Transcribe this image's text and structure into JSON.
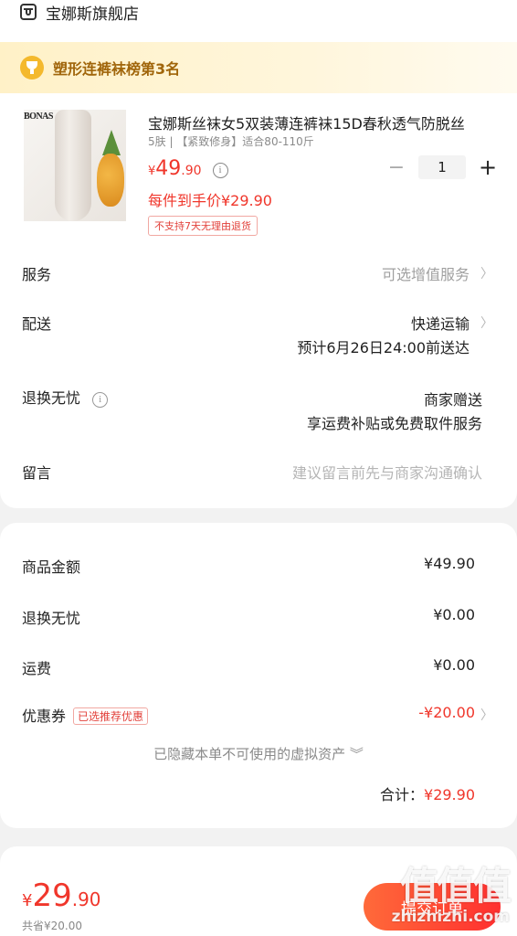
{
  "store": {
    "name": "宝娜斯旗舰店",
    "icon": "store-icon"
  },
  "rank_banner": {
    "text": "塑形连裤袜榜第3名",
    "icon": "trophy-icon"
  },
  "product": {
    "brand_logo_text": "BONAS",
    "title": "宝娜斯丝袜女5双装薄连裤袜15D春秋透气防脱丝",
    "spec": "5肤 | 【紧致修身】适合80-110斤",
    "price_symbol": "¥",
    "price_int": "49",
    "price_dec": ".90",
    "net_price": "每件到手价¥29.90",
    "return_tag": "不支持7天无理由退货",
    "quantity": "1",
    "minus": "−",
    "plus": "+"
  },
  "rows": {
    "service": {
      "label": "服务",
      "value": "可选增值服务"
    },
    "delivery": {
      "label": "配送",
      "value": "快递运输",
      "eta": "预计6月26日24:00前送达"
    },
    "worry_free": {
      "label": "退换无忧",
      "value": "商家赠送",
      "sub": "享运费补贴或免费取件服务"
    },
    "message": {
      "label": "留言",
      "placeholder": "建议留言前先与商家沟通确认"
    }
  },
  "summary": {
    "goods_label": "商品金额",
    "goods_amount": "¥49.90",
    "worry_label": "退换无忧",
    "worry_amount": "¥0.00",
    "shipping_label": "运费",
    "shipping_amount": "¥0.00",
    "coupon_label": "优惠券",
    "coupon_tag": "已选推荐优惠",
    "coupon_amount": "-¥20.00",
    "hidden_note": "已隐藏本单不可使用的虚拟资产 ︾",
    "total_label": "合计：",
    "total_amount": "¥29.90"
  },
  "bottom": {
    "price_symbol": "¥",
    "price_int": "29",
    "price_dec": ".90",
    "saved": "共省¥20.00",
    "submit": "提交订单"
  },
  "watermark": {
    "glyph": "值值值",
    "site": "zhizhizhi.com"
  },
  "colors": {
    "accent_red": "#f0362b",
    "banner_gold": "#a0650a",
    "background": "#f2f2f2"
  }
}
